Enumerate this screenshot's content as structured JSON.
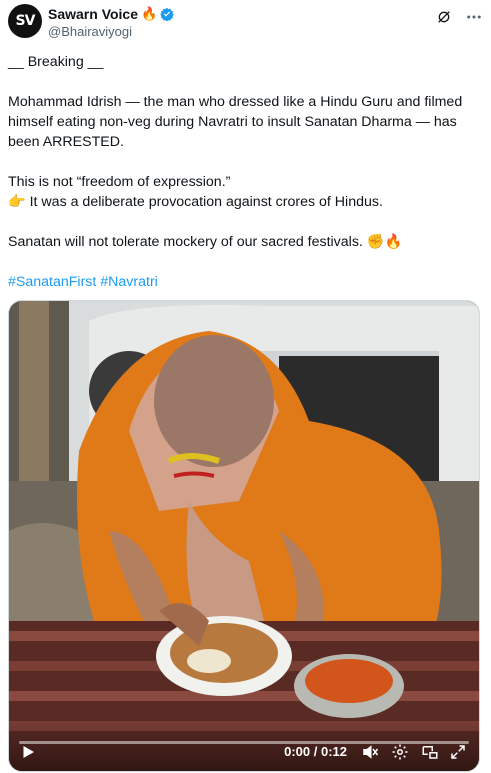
{
  "author": {
    "avatar_text": "SV",
    "display_name": "Sawarn Voice",
    "name_emoji": "🔥",
    "handle": "@Bhairaviyogi"
  },
  "post": {
    "line1": "__ Breaking __",
    "line2": "Mohammad Idrish — the man who dressed like a Hindu Guru and filmed himself eating non-veg during Navratri to insult Sanatan Dharma — has been ARRESTED.",
    "line3": "This is not “freedom of expression.”",
    "line4": "👉 It was a deliberate provocation against crores of Hindus.",
    "line5": "Sanatan will not tolerate mockery of our sacred festivals. ✊🔥",
    "hashtags": "#SanatanFirst #Navratri"
  },
  "video": {
    "time_display": "0:00 / 0:12",
    "progress": 0.0
  },
  "icons": {
    "verified": "verified-badge-icon",
    "grok": "grok-icon",
    "more": "more-icon",
    "play": "play-icon",
    "volume": "volume-icon",
    "settings": "settings-icon",
    "pip": "picture-in-picture-icon",
    "fullscreen": "fullscreen-icon"
  },
  "colors": {
    "accent": "#1d9bf0",
    "text": "#0f1419",
    "secondary": "#536471"
  }
}
